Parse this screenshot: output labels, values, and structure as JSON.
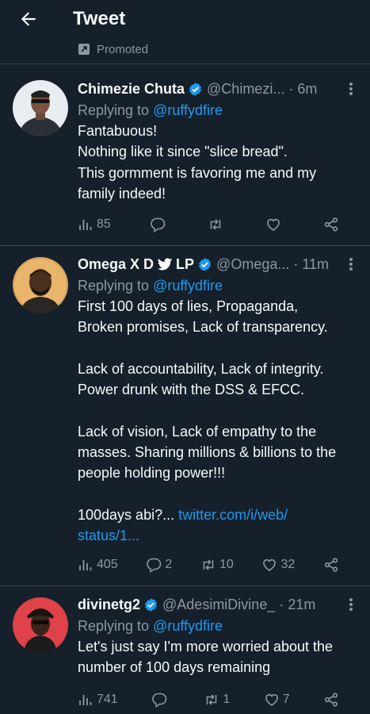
{
  "header": {
    "title": "Tweet"
  },
  "promoted": {
    "label": "Promoted"
  },
  "tweets": [
    {
      "name": "Chimezie Chuta",
      "verified": true,
      "handle": "@Chimezi...",
      "time": "· 6m",
      "reply_prefix": "Replying to ",
      "reply_mention": "@ruffydfire",
      "lines": [
        "Fantabuous!",
        "Nothing like it since \"slice bread\".",
        "This gormment is favoring me and my",
        "family indeed!"
      ],
      "views": "85",
      "replies": "",
      "retweets": "",
      "likes": ""
    },
    {
      "name_part1": "Omega X D",
      "name_part2": "LP",
      "verified": true,
      "handle": "@Omega...",
      "time": "· 11m",
      "reply_prefix": "Replying to ",
      "reply_mention": "@ruffydfire",
      "lines": [
        "First 100 days of lies, Propaganda,",
        "Broken promises, Lack of transparency.",
        "",
        "Lack of accountability, Lack of integrity.",
        "Power drunk with the DSS & EFCC.",
        "",
        "Lack of vision, Lack of empathy to the",
        "masses. Sharing millions & billions to the",
        "people holding power!!!",
        ""
      ],
      "last_line_prefix": "100days abi?... ",
      "link_part1": "twitter.com/i/web/",
      "link_part2": "status/1...",
      "views": "405",
      "replies": "2",
      "retweets": "10",
      "likes": "32"
    },
    {
      "name": "divinetg2",
      "verified": true,
      "handle": "@AdesimiDivine_",
      "time": "· 21m",
      "reply_prefix": "Replying to ",
      "reply_mention": "@ruffydfire",
      "lines": [
        "Let's just say I'm more worried about the",
        "number of 100 days remaining"
      ],
      "views": "741",
      "replies": "",
      "retweets": "1",
      "likes": "7"
    }
  ],
  "colors": {
    "background": "#15202b",
    "text": "#f7f9f9",
    "muted": "#8b98a5",
    "accent": "#1d9bf0",
    "divider": "#38444d"
  },
  "icons": [
    "back-arrow-icon",
    "promoted-icon",
    "verified-badge-icon",
    "twitter-bird-icon",
    "more-icon",
    "views-icon",
    "reply-icon",
    "retweet-icon",
    "like-icon",
    "share-icon"
  ]
}
